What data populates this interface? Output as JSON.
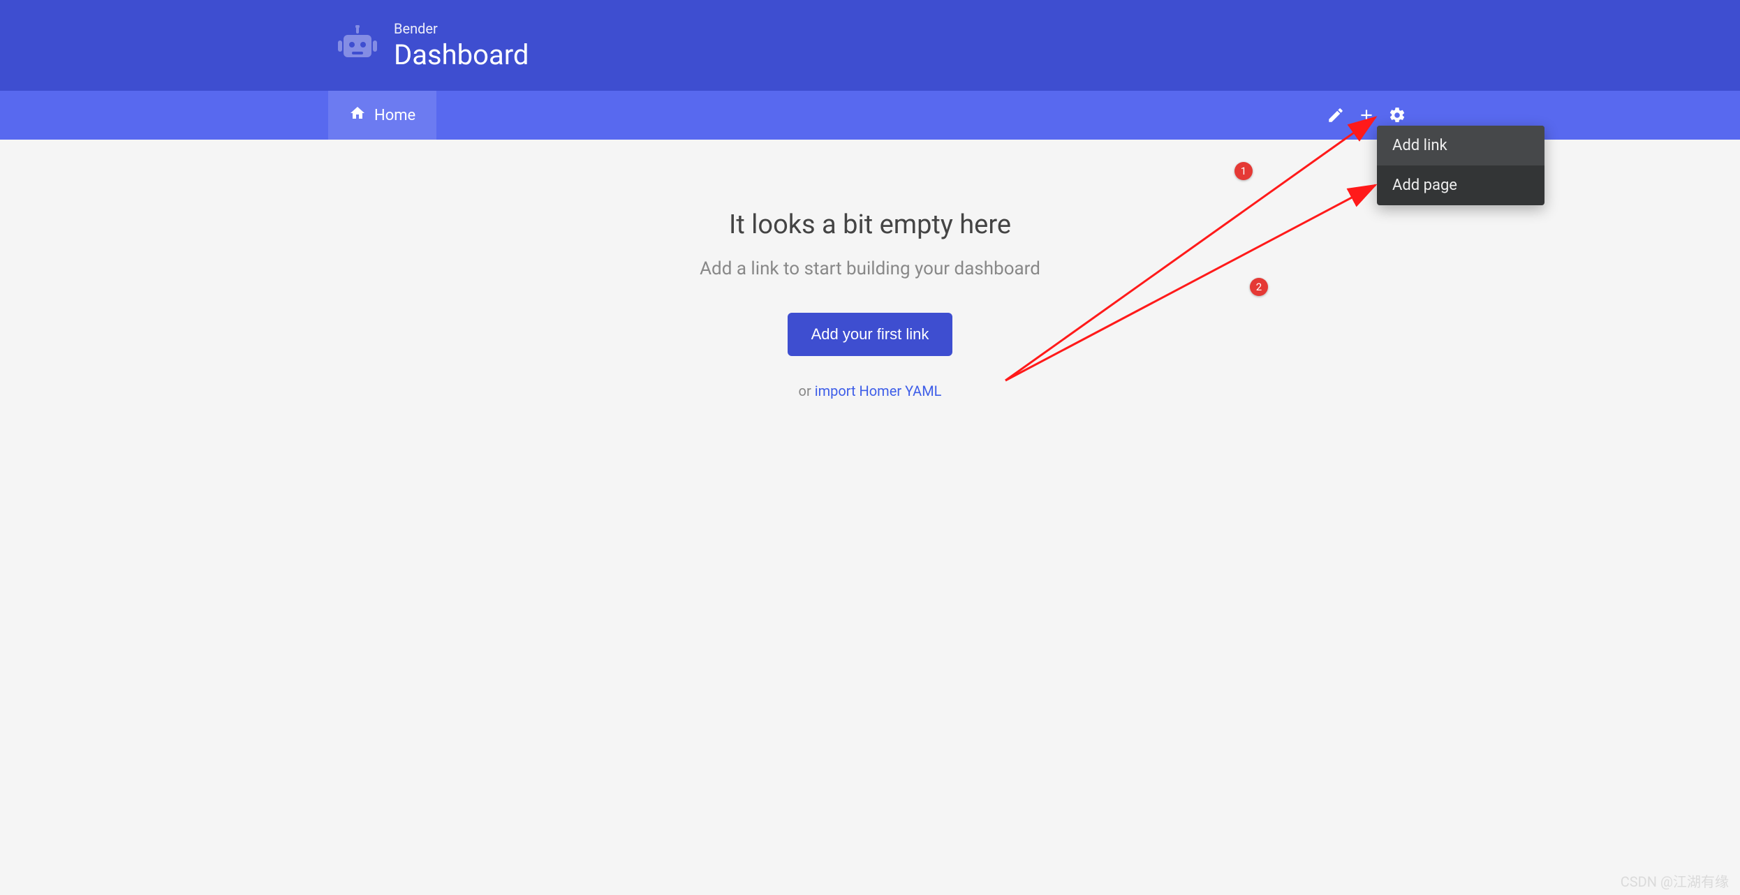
{
  "header": {
    "subtitle": "Bender",
    "title": "Dashboard"
  },
  "nav": {
    "home_label": "Home"
  },
  "empty": {
    "heading": "It looks a bit empty here",
    "sub": "Add a link to start building your dashboard",
    "button": "Add your first link",
    "or_prefix": "or ",
    "or_link": "import Homer YAML"
  },
  "dropdown": {
    "items": [
      "Add link",
      "Add page"
    ]
  },
  "annotations": {
    "badges": [
      "1",
      "2"
    ]
  },
  "watermark": "CSDN @江湖有缘"
}
